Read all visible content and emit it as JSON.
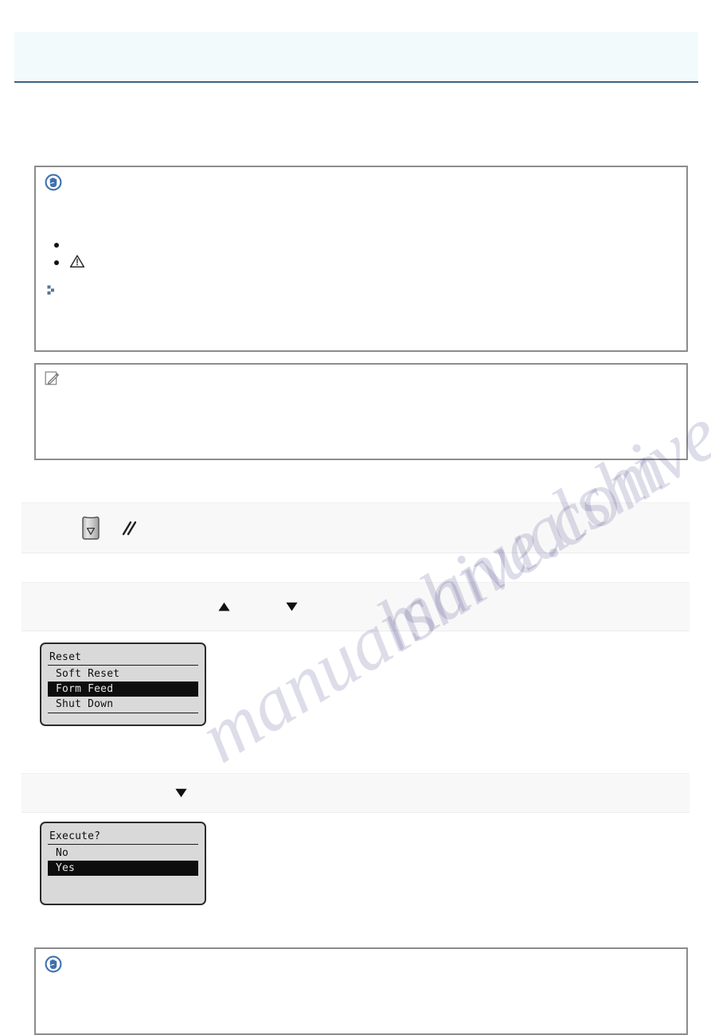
{
  "header": {
    "title": ""
  },
  "notices": {
    "important_top": {
      "label": "",
      "icon": "important-stop-hand-icon",
      "line_1": "",
      "bullets": [
        {
          "text_before": "",
          "icon": "",
          "text_after": ""
        },
        {
          "text_before": "",
          "icon": "warning-triangle-icon",
          "text_after": ""
        }
      ],
      "sub_note": {
        "icon": "blue-step-arrow-icon",
        "text": ""
      },
      "line_2": ""
    },
    "note": {
      "label": "",
      "icon": "note-pencil-icon",
      "line_1": "",
      "line_2": ""
    },
    "important_bottom": {
      "label": "",
      "icon": "important-stop-hand-icon",
      "line_1": ""
    }
  },
  "steps": [
    {
      "number": "",
      "text_before": "",
      "icons": [
        "panel-key-down-icon",
        "double-slash-separator-icon"
      ],
      "text_after": ""
    },
    {
      "number": "",
      "text_before": "",
      "icons": [
        "triangle-up-icon",
        "triangle-down-icon"
      ],
      "text_after": ""
    },
    {
      "number": "",
      "text_before": "",
      "icons": [
        "triangle-down-icon"
      ],
      "text_after": ""
    }
  ],
  "lcd_screens": [
    {
      "name": "reset-menu",
      "title": "Reset",
      "rows": [
        {
          "label": "Soft Reset",
          "selected": false
        },
        {
          "label": "Form Feed",
          "selected": true
        },
        {
          "label": "Shut Down",
          "selected": false
        }
      ],
      "has_bottom_rule": true
    },
    {
      "name": "execute-confirm",
      "title": "Execute?",
      "rows": [
        {
          "label": "No",
          "selected": false
        },
        {
          "label": "Yes",
          "selected": true
        }
      ],
      "has_bottom_rule": false
    }
  ],
  "watermark": {
    "text_a": "manualshive.com",
    "text_b": "manualshive.com"
  },
  "colors": {
    "banner_bg": "#f3fafb",
    "banner_border": "#3c6280",
    "notice_border": "#8c8c8c",
    "step_band_bg": "#f8f8f8",
    "lcd_bg": "#d9d9d9",
    "lcd_ink": "#0d0d0d",
    "accent_blue": "#2f5c96"
  }
}
